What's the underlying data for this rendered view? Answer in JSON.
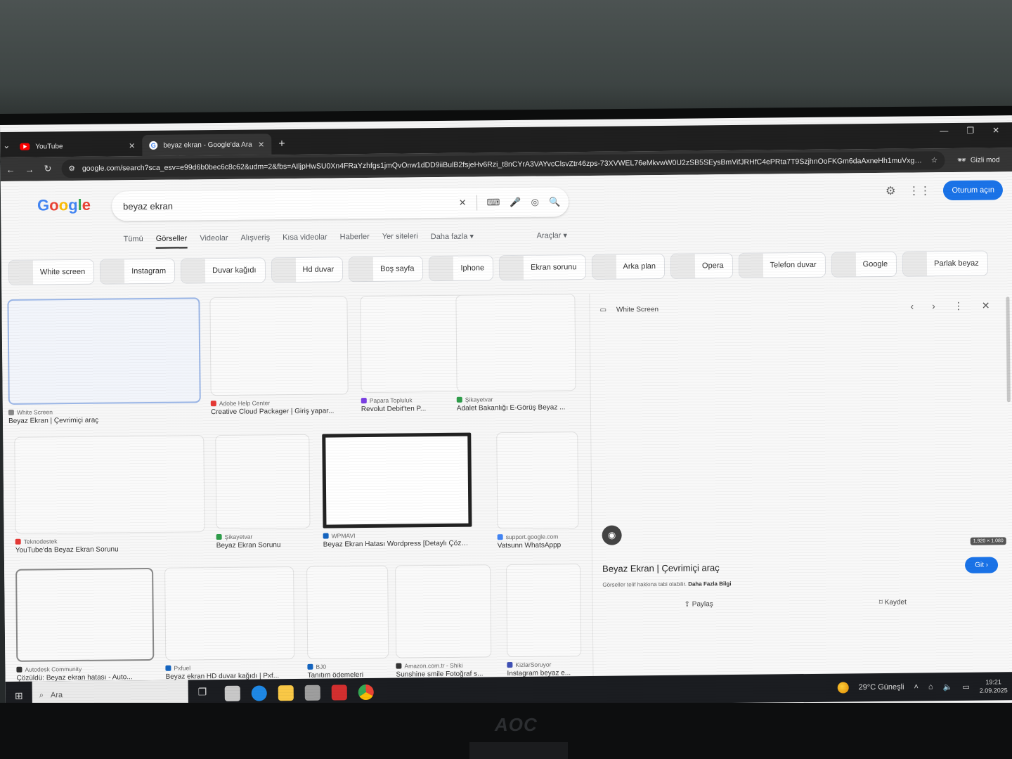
{
  "browser": {
    "tabs": [
      {
        "label": "YouTube",
        "icon": "youtube-icon"
      },
      {
        "label": "beyaz ekran - Google'da Ara",
        "icon": "google-icon"
      }
    ],
    "url": "google.com/search?sca_esv=e99d6b0bec6c8c62&udm=2&fbs=AIljpHwSU0Xn4FRaYzhfgs1jmQvOnw1dDD9iiBulB2fsjeHv6Rzi_t8nCYrA3VAYvcClsvZtr46zps-73XVWEL76eMkvwW0U2zSB5SEysBmVifJRHfC4ePRta7T9SzjhnOoFKGm6daAxneHh1muVxgUbxU...",
    "incognito_label": "Gizli mod"
  },
  "google": {
    "logo": [
      "G",
      "o",
      "o",
      "g",
      "l",
      "e"
    ],
    "query": "beyaz ekran",
    "signin": "Oturum açın",
    "nav": [
      "Tümü",
      "Görseller",
      "Videolar",
      "Alışveriş",
      "Kısa videolar",
      "Haberler",
      "Yer siteleri",
      "Daha fazla"
    ],
    "active_nav": "Görseller",
    "tools": "Araçlar",
    "chips": [
      "White screen",
      "Instagram",
      "Duvar kağıdı",
      "Hd duvar",
      "Boş sayfa",
      "Iphone",
      "Ekran sorunu",
      "Arka plan",
      "Opera",
      "Telefon duvar",
      "Google",
      "Parlak beyaz"
    ]
  },
  "results": [
    {
      "source": "White Screen",
      "title": "Beyaz Ekran | Çevrimiçi araç"
    },
    {
      "source": "Adobe Help Center",
      "title": "Creative Cloud Packager | Giriş yapar..."
    },
    {
      "source": "Papara Topluluk",
      "title": "Revolut Debit'ten P..."
    },
    {
      "source": "Şikayetvar",
      "title": "Adalet Bakanlığı E-Görüş Beyaz ..."
    },
    {
      "source": "Teknodestek",
      "title": "YouTube'da Beyaz Ekran Sorunu"
    },
    {
      "source": "Şikayetvar",
      "title": "Beyaz Ekran Sorunu"
    },
    {
      "source": "WPMAVI",
      "title": "Beyaz Ekran Hatası Wordpress [Detaylı Çözüm]"
    },
    {
      "source": "support.google.com",
      "title": "Vatsunn WhatsAppp"
    },
    {
      "source": "Autodesk Community",
      "title": "Çözüldü: Beyaz ekran hatası - Auto..."
    },
    {
      "source": "Pxfuel",
      "title": "Beyaz ekran HD duvar kağıdı | Pxf..."
    },
    {
      "source": "BJ0",
      "title": "Tanıtım ödemeleri"
    },
    {
      "source": "Amazon.com.tr - Shiki",
      "title": "Sunshine smile Fotoğraf s..."
    },
    {
      "source": "KizlarSoruyor",
      "title": "Instagram beyaz e..."
    }
  ],
  "preview": {
    "source": "White Screen",
    "dimensions": "1.920 × 1.080",
    "title": "Beyaz Ekran | Çevrimiçi araç",
    "go": "Git",
    "note_prefix": "Görseller telif hakkına tabi olabilir.",
    "note_link": "Daha Fazla Bilgi",
    "share": "Paylaş",
    "save": "Kaydet"
  },
  "taskbar": {
    "search": "Ara",
    "weather": "29°C  Güneşli",
    "time": "19:21",
    "date": "2.09.2025"
  },
  "monitor_brand": "AOC",
  "colors": {
    "accent": "#1a73e8",
    "taskbar": "#1b1d21",
    "chrome": "#1f1f1f"
  }
}
